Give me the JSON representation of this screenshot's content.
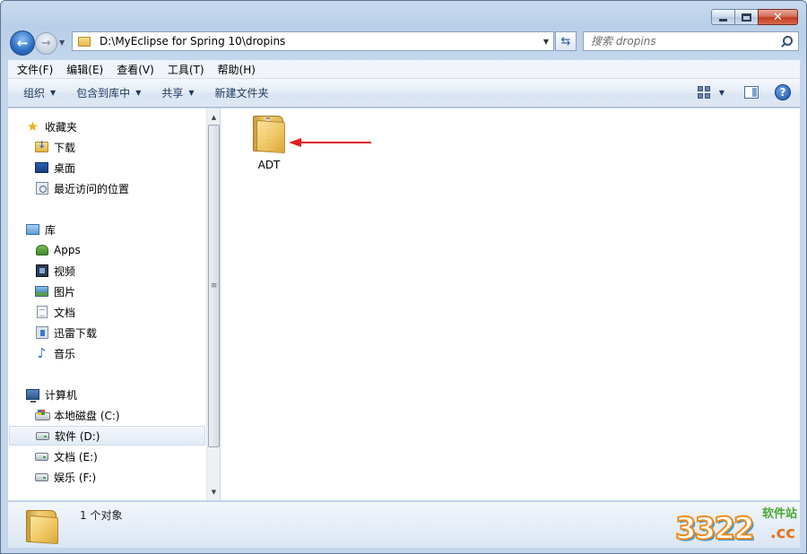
{
  "window": {
    "controls": {
      "minimize": "",
      "maximize": "",
      "close": "✕"
    }
  },
  "address": {
    "path": "D:\\MyEclipse for Spring 10\\dropins",
    "search_placeholder": "搜索 dropins"
  },
  "menu": [
    "文件(F)",
    "编辑(E)",
    "查看(V)",
    "工具(T)",
    "帮助(H)"
  ],
  "toolbar": {
    "organize": "组织",
    "include_in_library": "包含到库中",
    "share": "共享",
    "new_folder": "新建文件夹"
  },
  "nav": {
    "favorites": {
      "label": "收藏夹",
      "items": [
        "下载",
        "桌面",
        "最近访问的位置"
      ]
    },
    "libraries": {
      "label": "库",
      "items": [
        "Apps",
        "视频",
        "图片",
        "文档",
        "迅雷下载",
        "音乐"
      ]
    },
    "computer": {
      "label": "计算机",
      "items": [
        "本地磁盘 (C:)",
        "软件 (D:)",
        "文档 (E:)",
        "娱乐 (F:)"
      ],
      "selected": "软件 (D:)"
    }
  },
  "content": {
    "items": [
      {
        "name": "ADT",
        "type": "folder"
      }
    ]
  },
  "details": {
    "text": "1 个对象"
  },
  "watermark": {
    "site": "软件站",
    "number": "3322",
    "tld": ".cc"
  },
  "colors": {
    "annotation_arrow": "#e02020",
    "accent": "#2a6cc2"
  }
}
